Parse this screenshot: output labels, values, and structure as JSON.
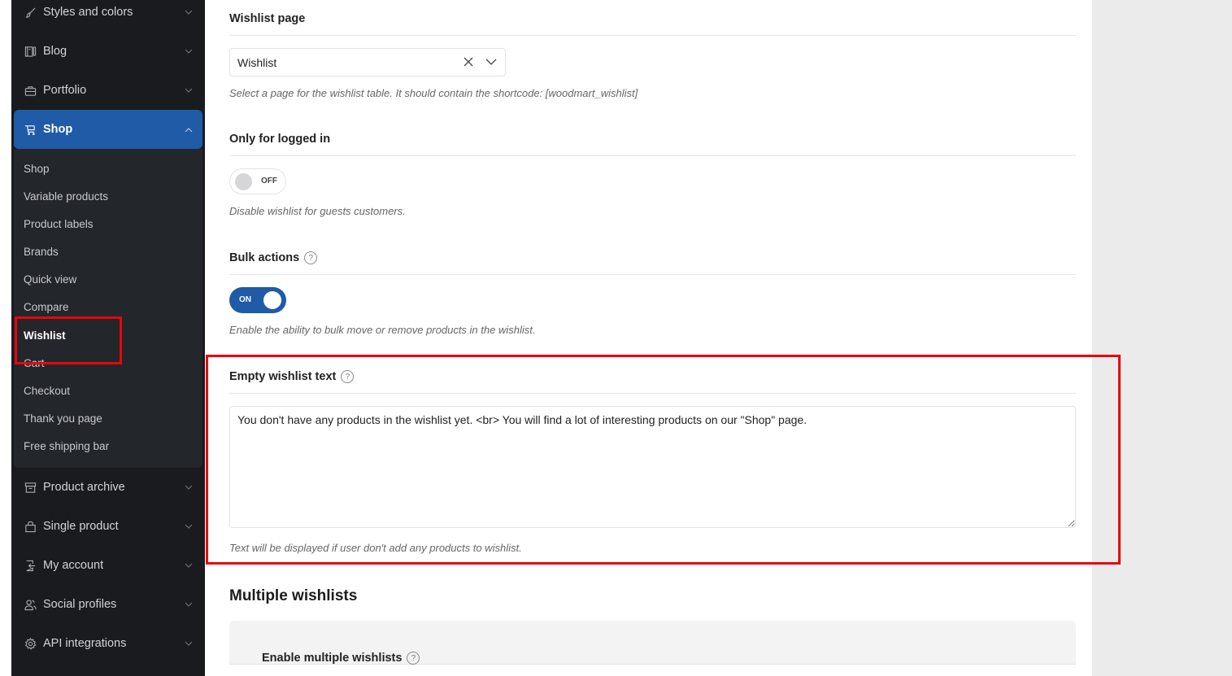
{
  "sidebar": {
    "top_items": [
      {
        "label": "Styles and colors",
        "icon": "brush-icon"
      },
      {
        "label": "Blog",
        "icon": "blog-icon"
      },
      {
        "label": "Portfolio",
        "icon": "briefcase-icon"
      }
    ],
    "active_item": {
      "label": "Shop",
      "icon": "cart-icon",
      "expanded": true
    },
    "submenu": [
      {
        "label": "Shop"
      },
      {
        "label": "Variable products"
      },
      {
        "label": "Product labels"
      },
      {
        "label": "Brands"
      },
      {
        "label": "Quick view"
      },
      {
        "label": "Compare"
      },
      {
        "label": "Wishlist",
        "current": true
      },
      {
        "label": "Cart"
      },
      {
        "label": "Checkout"
      },
      {
        "label": "Thank you page"
      },
      {
        "label": "Free shipping bar"
      }
    ],
    "bottom_items": [
      {
        "label": "Product archive",
        "icon": "archive-icon"
      },
      {
        "label": "Single product",
        "icon": "bag-icon"
      },
      {
        "label": "My account",
        "icon": "login-icon"
      },
      {
        "label": "Social profiles",
        "icon": "users-icon"
      },
      {
        "label": "API integrations",
        "icon": "gear-icon"
      }
    ]
  },
  "fields": {
    "wishlist_page": {
      "title": "Wishlist page",
      "value": "Wishlist",
      "description": "Select a page for the wishlist table. It should contain the shortcode: [woodmart_wishlist]"
    },
    "only_logged_in": {
      "title": "Only for logged in",
      "state": "OFF",
      "description": "Disable wishlist for guests customers."
    },
    "bulk_actions": {
      "title": "Bulk actions",
      "help": "?",
      "state": "ON",
      "description": "Enable the ability to bulk move or remove products in the wishlist."
    },
    "empty_text": {
      "title": "Empty wishlist text",
      "help": "?",
      "value": "You don't have any products in the wishlist yet. <br> You will find a lot of interesting products on our \"Shop\" page.",
      "description": "Text will be displayed if user don't add any products to wishlist."
    }
  },
  "multiple_wishlists": {
    "section_title": "Multiple wishlists",
    "enable_title": "Enable multiple wishlists",
    "help": "?"
  },
  "colors": {
    "accent": "#1f5ba6",
    "sidebar_bg": "#191b1f",
    "submenu_bg": "#23262b",
    "highlight": "#e8060c"
  }
}
